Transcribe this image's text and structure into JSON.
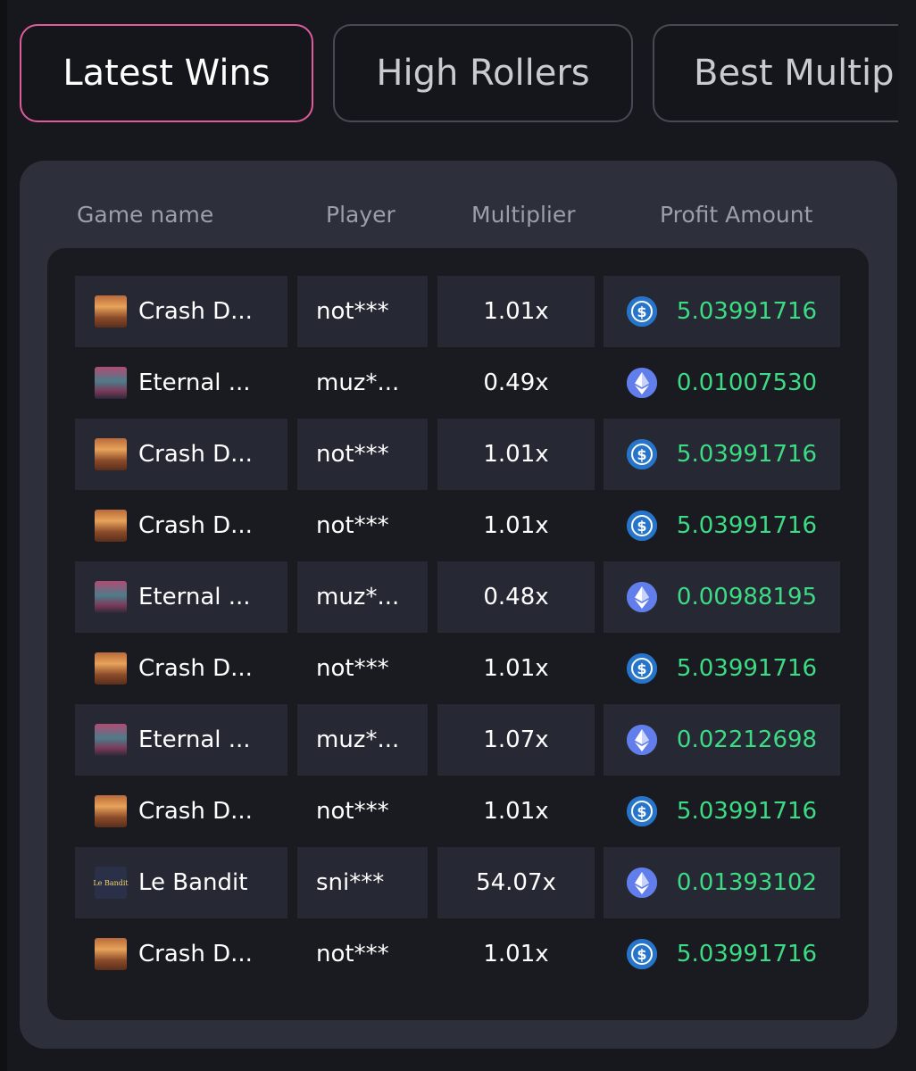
{
  "tabs": [
    {
      "label": "Latest Wins",
      "active": true
    },
    {
      "label": "High Rollers",
      "active": false
    },
    {
      "label": "Best Multip",
      "active": false
    }
  ],
  "table": {
    "headers": {
      "game": "Game name",
      "player": "Player",
      "multiplier": "Multiplier",
      "profit": "Profit Amount"
    },
    "rows": [
      {
        "game": "Crash D...",
        "thumb": "crash",
        "player": "not***",
        "multiplier": "1.01x",
        "coin": "usdc-icon",
        "profit": "5.03991716"
      },
      {
        "game": "Eternal ...",
        "thumb": "eternal",
        "player": "muz*...",
        "multiplier": "0.49x",
        "coin": "eth-icon",
        "profit": "0.01007530"
      },
      {
        "game": "Crash D...",
        "thumb": "crash",
        "player": "not***",
        "multiplier": "1.01x",
        "coin": "usdc-icon",
        "profit": "5.03991716"
      },
      {
        "game": "Crash D...",
        "thumb": "crash",
        "player": "not***",
        "multiplier": "1.01x",
        "coin": "usdc-icon",
        "profit": "5.03991716"
      },
      {
        "game": "Eternal ...",
        "thumb": "eternal",
        "player": "muz*...",
        "multiplier": "0.48x",
        "coin": "eth-icon",
        "profit": "0.00988195"
      },
      {
        "game": "Crash D...",
        "thumb": "crash",
        "player": "not***",
        "multiplier": "1.01x",
        "coin": "usdc-icon",
        "profit": "5.03991716"
      },
      {
        "game": "Eternal ...",
        "thumb": "eternal",
        "player": "muz*...",
        "multiplier": "1.07x",
        "coin": "eth-icon",
        "profit": "0.02212698"
      },
      {
        "game": "Crash D...",
        "thumb": "crash",
        "player": "not***",
        "multiplier": "1.01x",
        "coin": "usdc-icon",
        "profit": "5.03991716"
      },
      {
        "game": "Le Bandit",
        "thumb": "bandit",
        "thumb_text": "Le Bandit",
        "player": "sni***",
        "multiplier": "54.07x",
        "coin": "eth-icon",
        "profit": "0.01393102"
      },
      {
        "game": "Crash D...",
        "thumb": "crash",
        "player": "not***",
        "multiplier": "1.01x",
        "coin": "usdc-icon",
        "profit": "5.03991716"
      }
    ]
  },
  "colors": {
    "active_tab_border": "#e05a9e",
    "profit_green": "#3ddc84",
    "usdc_blue": "#2775ca",
    "eth_purple": "#627eea"
  }
}
